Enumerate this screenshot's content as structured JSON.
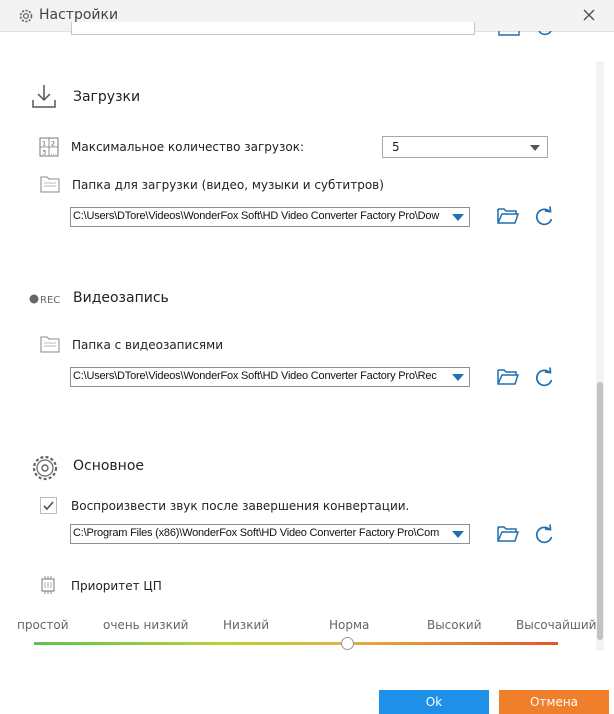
{
  "window": {
    "title": "Настройки",
    "icon": "gear-icon",
    "close_icon": "close-icon"
  },
  "downloads": {
    "title": "Загрузки",
    "icon": "download-icon",
    "max_label": "Максимальное количество загрузок:",
    "max_value": "5",
    "folder_label": "Папка для загрузки (видео, музыки и субтитров)",
    "folder_path": "C:\\Users\\DTore\\Videos\\WonderFox Soft\\HD Video Converter Factory Pro\\Dow"
  },
  "recording": {
    "title": "Видеозапись",
    "icon_text": "REC",
    "folder_label": "Папка с видеозаписями",
    "folder_path": "C:\\Users\\DTore\\Videos\\WonderFox Soft\\HD Video Converter Factory Pro\\Rec"
  },
  "general": {
    "title": "Основное",
    "icon": "gear-icon",
    "sound_label": "Воспроизвести звук после завершения конвертации.",
    "sound_checked": true,
    "sound_path": "C:\\Program Files (x86)\\WonderFox Soft\\HD Video Converter Factory Pro\\Com",
    "cpu_label": "Приоритет ЦП",
    "priority_levels": [
      "простой",
      "очень низкий",
      "Низкий",
      "Норма",
      "Высокий",
      "Высочайший"
    ],
    "priority_selected": "Норма"
  },
  "buttons": {
    "ok": "Ok",
    "cancel": "Отмена"
  },
  "colors": {
    "accent": "#1f6fb2",
    "ok": "#1e90e8",
    "cancel": "#f07f2b"
  }
}
